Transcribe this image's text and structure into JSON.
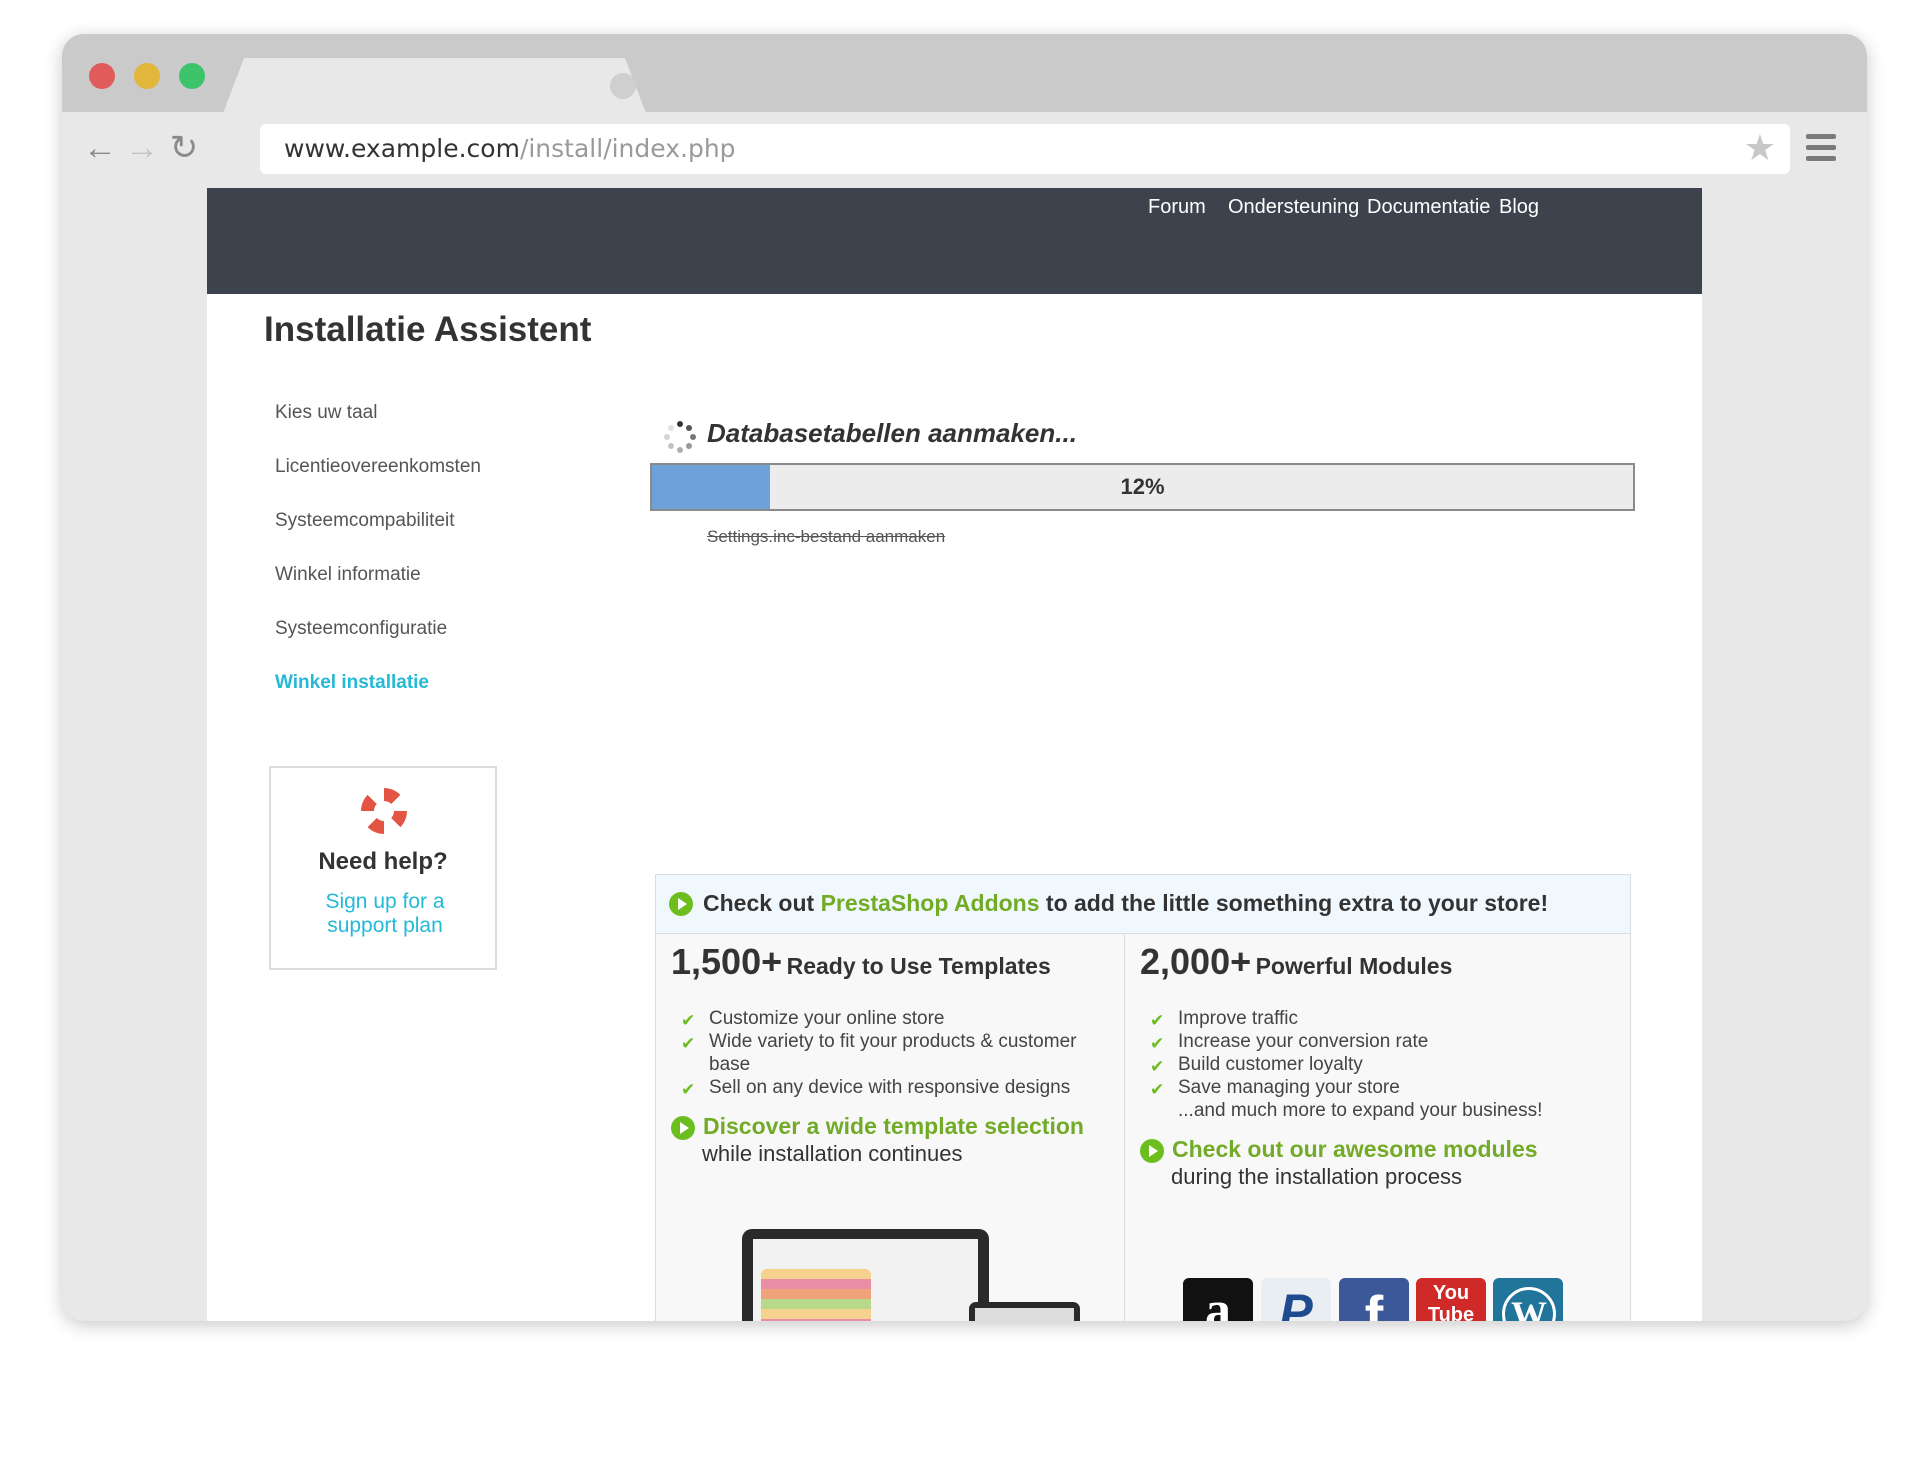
{
  "browser": {
    "url_host": "www.example.com",
    "url_path": "/install/index.php",
    "icons": {
      "back": "arrow-left-icon",
      "forward": "arrow-right-icon",
      "reload": "reload-icon",
      "bookmark": "star-icon",
      "menu": "hamburger-menu-icon"
    }
  },
  "topnav": {
    "links": [
      "Forum",
      "Ondersteuning",
      "Documentatie",
      "Blog"
    ]
  },
  "page": {
    "title": "Installatie Assistent"
  },
  "steps": [
    {
      "label": "Kies uw taal",
      "active": false
    },
    {
      "label": "Licentieovereenkomsten",
      "active": false
    },
    {
      "label": "Systeemcompabiliteit",
      "active": false
    },
    {
      "label": "Winkel informatie",
      "active": false
    },
    {
      "label": "Systeemconfiguratie",
      "active": false
    },
    {
      "label": "Winkel installatie",
      "active": true
    }
  ],
  "help": {
    "icon": "lifebuoy-icon",
    "title": "Need help?",
    "link": "Sign up for a support plan"
  },
  "progress": {
    "title": "Databasetabellen aanmaken...",
    "percent": 12,
    "label": "12%",
    "completed_step": "Settings.inc-bestand aanmaken"
  },
  "promo": {
    "headline_pre": "Check out ",
    "headline_link": "PrestaShop Addons",
    "headline_post": " to add the little something extra to your store!",
    "templates": {
      "count": "1,500+",
      "label": "Ready to Use Templates",
      "features": [
        "Customize your online store",
        "Wide variety to fit your products & customer base",
        "Sell on any device with responsive designs"
      ],
      "cta": "Discover a wide template selection",
      "cta_sub": "while installation continues"
    },
    "modules": {
      "count": "2,000+",
      "label": "Powerful Modules",
      "features": [
        "Improve traffic",
        "Increase your conversion rate",
        "Build customer loyalty",
        "Save managing your store"
      ],
      "more": "...and much more to expand your business!",
      "cta": "Check out our awesome modules",
      "cta_sub": "during the installation process"
    },
    "logos": {
      "amazon": "a",
      "paypal": "P",
      "facebook": "f",
      "youtube": "You Tube",
      "wordpress": "W"
    }
  },
  "colors": {
    "accent_blue": "#25b9d7",
    "accent_green": "#72ab27",
    "nav_bg": "#3c434d",
    "progress_fill": "#6fa1d9"
  }
}
